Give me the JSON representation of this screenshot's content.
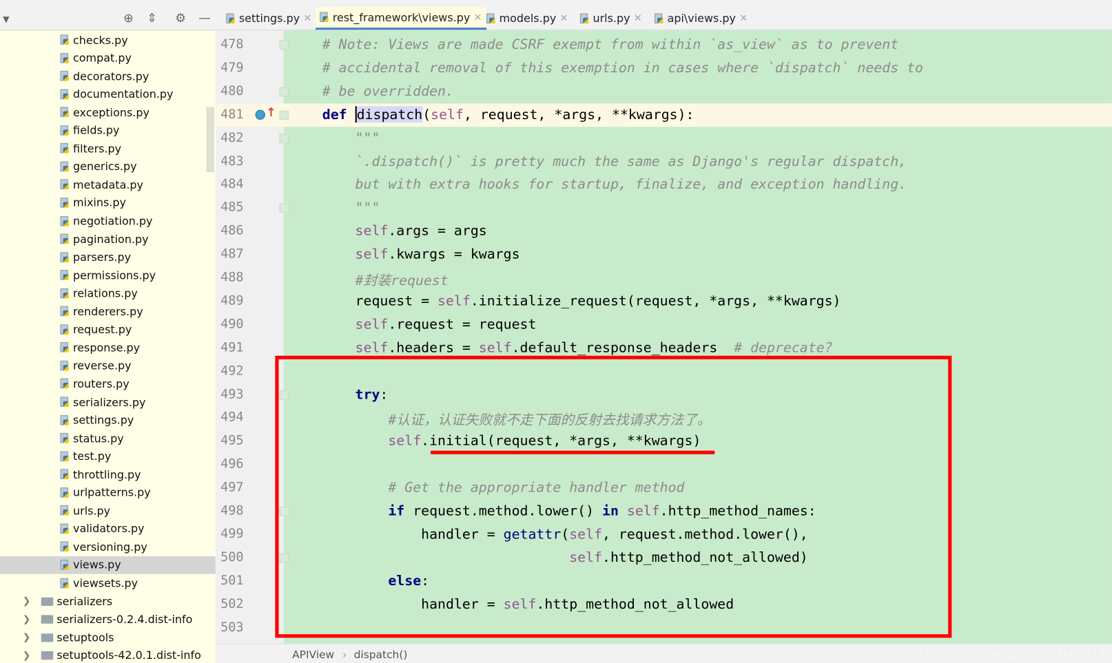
{
  "tabs": [
    {
      "label": "settings.py",
      "active": false
    },
    {
      "label": "rest_framework\\views.py",
      "active": true
    },
    {
      "label": "models.py",
      "active": false
    },
    {
      "label": "urls.py",
      "active": false
    },
    {
      "label": "api\\views.py",
      "active": false
    }
  ],
  "sidebar": {
    "toolbar_icons": [
      "dropdown-icon",
      "locate-icon",
      "collapse-icon",
      "gear-icon",
      "minimize-icon"
    ],
    "files": [
      "checks.py",
      "compat.py",
      "decorators.py",
      "documentation.py",
      "exceptions.py",
      "fields.py",
      "filters.py",
      "generics.py",
      "metadata.py",
      "mixins.py",
      "negotiation.py",
      "pagination.py",
      "parsers.py",
      "permissions.py",
      "relations.py",
      "renderers.py",
      "request.py",
      "response.py",
      "reverse.py",
      "routers.py",
      "serializers.py",
      "settings.py",
      "status.py",
      "test.py",
      "throttling.py",
      "urlpatterns.py",
      "urls.py",
      "validators.py",
      "versioning.py",
      "views.py",
      "viewsets.py"
    ],
    "selected": "views.py",
    "folders": [
      "serializers",
      "serializers-0.2.4.dist-info",
      "setuptools",
      "setuptools-42.0.1.dist-info"
    ]
  },
  "editor": {
    "lines": [
      {
        "n": "478",
        "html": "    <span class='c'># Note: Views are made CSRF exempt from within `as_view` as to prevent</span>"
      },
      {
        "n": "479",
        "html": "    <span class='c'># accidental removal of this exemption in cases where `dispatch` needs to</span>"
      },
      {
        "n": "480",
        "html": "    <span class='c'># be overridden.</span>"
      },
      {
        "n": "481",
        "html": "    <span class='k'>def</span> <span class='fn'><span class='caret'></span>dispatch</span>(<span class='s'>self</span>, request, *args, **kwargs):"
      },
      {
        "n": "482",
        "html": "        <span class='c'>\"\"\"</span>"
      },
      {
        "n": "483",
        "html": "        <span class='c'>`.dispatch()` is pretty much the same as Django's regular dispatch,</span>"
      },
      {
        "n": "484",
        "html": "        <span class='c'>but with extra hooks for startup, finalize, and exception handling.</span>"
      },
      {
        "n": "485",
        "html": "        <span class='c'>\"\"\"</span>"
      },
      {
        "n": "486",
        "html": "        <span class='s'>self</span>.args = args"
      },
      {
        "n": "487",
        "html": "        <span class='s'>self</span>.kwargs = kwargs"
      },
      {
        "n": "488",
        "html": "        <span class='c'>#封装request</span>"
      },
      {
        "n": "489",
        "html": "        request = <span class='s'>self</span>.initialize_request(request, *args, **kwargs)"
      },
      {
        "n": "490",
        "html": "        <span class='s'>self</span>.request = request"
      },
      {
        "n": "491",
        "html": "        <span class='s'>self</span>.headers = <span class='s'>self</span>.default_response_headers  <span class='c'># deprecate?</span>"
      },
      {
        "n": "492",
        "html": ""
      },
      {
        "n": "493",
        "html": "        <span class='k'>try</span>:"
      },
      {
        "n": "494",
        "html": "            <span class='c'>#认证，认证失败就不走下面的反射去找请求方法了。</span>"
      },
      {
        "n": "495",
        "html": "            <span class='s'>self</span>.initial(request, *args, **kwargs)"
      },
      {
        "n": "496",
        "html": ""
      },
      {
        "n": "497",
        "html": "            <span class='c'># Get the appropriate handler method</span>"
      },
      {
        "n": "498",
        "html": "            <span class='k'>if</span> request.method.lower() <span class='k'>in</span> <span class='s'>self</span>.http_method_names:"
      },
      {
        "n": "499",
        "html": "                handler = <span class='b'>getattr</span>(<span class='s'>self</span>, request.method.lower(),"
      },
      {
        "n": "500",
        "html": "                                  <span class='s'>self</span>.http_method_not_allowed)"
      },
      {
        "n": "501",
        "html": "            <span class='k'>else</span>:"
      },
      {
        "n": "502",
        "html": "                handler = <span class='s'>self</span>.http_method_not_allowed"
      },
      {
        "n": "503",
        "html": ""
      }
    ],
    "current_line": "481"
  },
  "breadcrumb": {
    "items": [
      "APIView",
      "dispatch()"
    ]
  },
  "watermark": "https://blog.csdn.net/weixin_43697214",
  "colors": {
    "code_bg": "#c8ebcb",
    "sidebar_bg": "#fffee6",
    "highlight": "#ff0000",
    "tab_accent": "#4083c9"
  }
}
